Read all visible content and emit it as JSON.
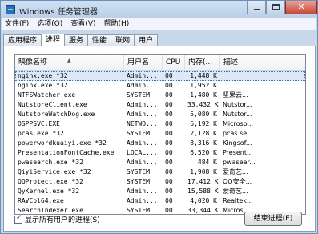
{
  "window": {
    "title": "Windows 任务管理器"
  },
  "menu": [
    "文件(F)",
    "选项(O)",
    "查看(V)",
    "帮助(H)"
  ],
  "tabs": [
    "应用程序",
    "进程",
    "服务",
    "性能",
    "联网",
    "用户"
  ],
  "active_tab": "进程",
  "columns": [
    "映像名称",
    "用户名",
    "CPU",
    "内存(...",
    "描述"
  ],
  "rows": [
    {
      "name": "nginx.exe *32",
      "user": "Admin...",
      "cpu": "00",
      "mem": "1,448 K",
      "desc": ""
    },
    {
      "name": "nginx.exe *32",
      "user": "Admin...",
      "cpu": "00",
      "mem": "1,952 K",
      "desc": ""
    },
    {
      "name": "NTFSWatcher.exe",
      "user": "SYSTEM",
      "cpu": "00",
      "mem": "1,480 K",
      "desc": "坚果云..."
    },
    {
      "name": "NutstoreClient.exe",
      "user": "Admin...",
      "cpu": "00",
      "mem": "33,432 K",
      "desc": "Nutstor..."
    },
    {
      "name": "NutstoreWatchDog.exe",
      "user": "Admin...",
      "cpu": "00",
      "mem": "5,080 K",
      "desc": "Nutstor..."
    },
    {
      "name": "OSPPSVC.EXE",
      "user": "NETWO...",
      "cpu": "00",
      "mem": "6,192 K",
      "desc": "Microso..."
    },
    {
      "name": "pcas.exe *32",
      "user": "SYSTEM",
      "cpu": "00",
      "mem": "2,128 K",
      "desc": "pcas se..."
    },
    {
      "name": "powerwordkuaiyi.exe *32",
      "user": "Admin...",
      "cpu": "00",
      "mem": "8,316 K",
      "desc": "Kingsof..."
    },
    {
      "name": "PresentationFontCache.exe",
      "user": "LOCAL...",
      "cpu": "00",
      "mem": "6,520 K",
      "desc": "Present..."
    },
    {
      "name": "pwasearch.exe *32",
      "user": "Admin...",
      "cpu": "00",
      "mem": "484 K",
      "desc": "pwasear..."
    },
    {
      "name": "QiyiService.exe *32",
      "user": "SYSTEM",
      "cpu": "00",
      "mem": "1,908 K",
      "desc": "爱奇艺..."
    },
    {
      "name": "QQProtect.exe *32",
      "user": "SYSTEM",
      "cpu": "00",
      "mem": "17,412 K",
      "desc": "QQ安全..."
    },
    {
      "name": "QyKernel.exe *32",
      "user": "Admin...",
      "cpu": "00",
      "mem": "15,588 K",
      "desc": "爱奇艺..."
    },
    {
      "name": "RAVCpl64.exe",
      "user": "Admin...",
      "cpu": "00",
      "mem": "4,020 K",
      "desc": "Realtek..."
    },
    {
      "name": "SearchIndexer.exe",
      "user": "SYSTEM",
      "cpu": "00",
      "mem": "33,344 K",
      "desc": "Micros..."
    }
  ],
  "show_all_label": "显示所有用户的进程(S)",
  "show_all_checked": true,
  "end_process_label": "结束进程(E)"
}
